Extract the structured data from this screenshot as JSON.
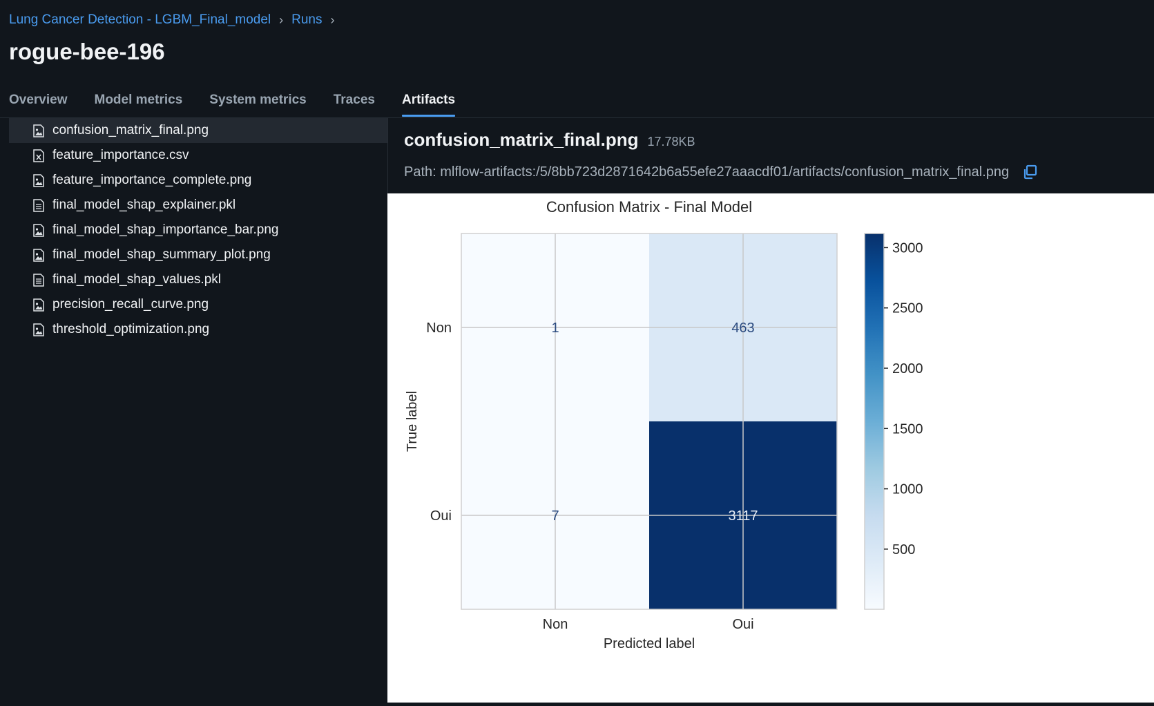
{
  "breadcrumb": {
    "experiment": "Lung Cancer Detection - LGBM_Final_model",
    "runs": "Runs"
  },
  "run_name": "rogue-bee-196",
  "tabs": [
    {
      "label": "Overview",
      "active": false
    },
    {
      "label": "Model metrics",
      "active": false
    },
    {
      "label": "System metrics",
      "active": false
    },
    {
      "label": "Traces",
      "active": false
    },
    {
      "label": "Artifacts",
      "active": true
    }
  ],
  "files": [
    {
      "name": "confusion_matrix_final.png",
      "icon": "image-file-icon",
      "selected": true
    },
    {
      "name": "feature_importance.csv",
      "icon": "csv-file-icon",
      "selected": false
    },
    {
      "name": "feature_importance_complete.png",
      "icon": "image-file-icon",
      "selected": false
    },
    {
      "name": "final_model_shap_explainer.pkl",
      "icon": "text-file-icon",
      "selected": false
    },
    {
      "name": "final_model_shap_importance_bar.png",
      "icon": "image-file-icon",
      "selected": false
    },
    {
      "name": "final_model_shap_summary_plot.png",
      "icon": "image-file-icon",
      "selected": false
    },
    {
      "name": "final_model_shap_values.pkl",
      "icon": "text-file-icon",
      "selected": false
    },
    {
      "name": "precision_recall_curve.png",
      "icon": "image-file-icon",
      "selected": false
    },
    {
      "name": "threshold_optimization.png",
      "icon": "image-file-icon",
      "selected": false
    }
  ],
  "artifact": {
    "name": "confusion_matrix_final.png",
    "size": "17.78KB",
    "path": "Path: mlflow-artifacts:/5/8bb723d2871642b6a55efe27aaacdf01/artifacts/confusion_matrix_final.png"
  },
  "colors": {
    "accent": "#4a9cf0",
    "background": "#11161c",
    "selected_row": "#232931"
  },
  "chart_data": {
    "type": "heatmap",
    "title": "Confusion Matrix - Final Model",
    "xlabel": "Predicted label",
    "ylabel": "True label",
    "x_categories": [
      "Non",
      "Oui"
    ],
    "y_categories": [
      "Non",
      "Oui"
    ],
    "values": [
      [
        1,
        463
      ],
      [
        7,
        3117
      ]
    ],
    "colorbar_ticks": [
      "500",
      "1000",
      "1500",
      "2000",
      "2500",
      "3000"
    ],
    "colorbar_tick_values": [
      500,
      1000,
      1500,
      2000,
      2500,
      3000
    ],
    "value_range": [
      1,
      3117
    ],
    "colormap": "Blues",
    "grid": true
  }
}
